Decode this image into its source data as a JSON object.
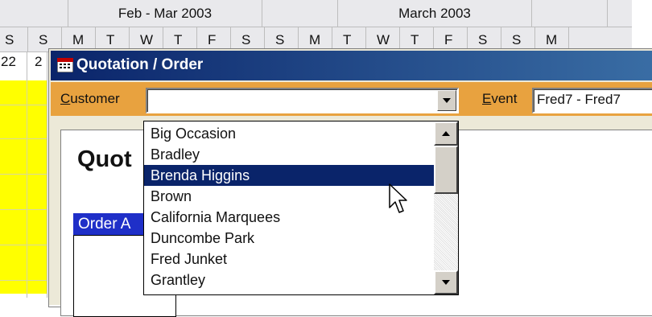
{
  "calendar": {
    "months": [
      "Feb - Mar 2003",
      "March 2003"
    ],
    "week_letters": [
      "S",
      "S",
      "M",
      "T",
      "W",
      "T",
      "F",
      "S",
      "S",
      "M",
      "T",
      "W",
      "T",
      "F",
      "S",
      "S",
      "M"
    ],
    "dates": [
      "22",
      "2"
    ]
  },
  "dialog": {
    "title": "Quotation / Order",
    "customer_label": "Customer",
    "customer_accesskey": "C",
    "customer_rest": "ustomer",
    "customer_value": "",
    "event_label": "Event",
    "event_accesskey": "E",
    "event_rest": "vent",
    "event_value": "Fred7 - Fred7",
    "heading": "Quot",
    "panel_heading": "Order A"
  },
  "dropdown": {
    "items": [
      "Big Occasion",
      "Bradley",
      "Brenda Higgins",
      "Brown",
      "California Marquees",
      "Duncombe Park",
      "Fred Junket",
      "Grantley"
    ],
    "selected_index": 2
  },
  "colors": {
    "titlebar": "#0a246a",
    "toolbar": "#e8a23f",
    "selection": "#0a246a",
    "panel_head": "#1f2fc8",
    "yellow": "#ffff00"
  }
}
